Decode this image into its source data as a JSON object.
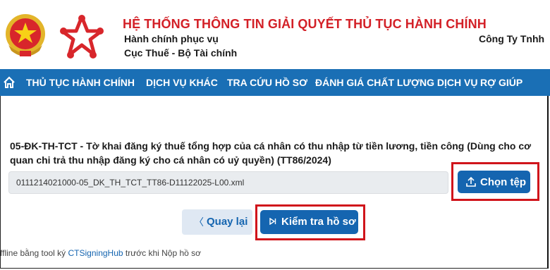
{
  "header": {
    "title": "HỆ THỐNG THÔNG TIN GIẢI QUYẾT THỦ TỤC HÀNH CHÍNH",
    "subtitle_1": "Hành chính phục vụ",
    "subtitle_2": "Cục Thuế - Bộ Tài chính",
    "company": "Công Ty Tnhh",
    "emblem_icon": "national-emblem-icon",
    "logo_icon": "public-service-logo-icon"
  },
  "nav": {
    "home_icon": "home-icon",
    "items": [
      "THỦ TỤC HÀNH CHÍNH",
      "DỊCH VỤ KHÁC",
      "TRA CỨU HỒ SƠ",
      "ĐÁNH GIÁ CHẤT LƯỢNG DỊCH VỤ",
      "RỢ GIÚP"
    ]
  },
  "form": {
    "title": "05-ĐK-TH-TCT - Tờ khai đăng ký thuế tổng hợp của cá nhân có thu nhập từ tiền lương, tiền công (Dùng cho cơ quan chi trả thu nhập đăng ký cho cá nhân có uỷ quyền) (TT86/2024)",
    "file_name": "0111214021000-05_DK_TH_TCT_TT86-D11122025-L00.xml",
    "choose_file_label": "Chọn tệp",
    "back_label": "Quay lại",
    "check_label": "Kiểm tra hồ sơ"
  },
  "footer": {
    "prefix": "ffline bằng tool ký ",
    "link": "CTSigningHub",
    "suffix": " trước khi Nộp hồ sơ"
  },
  "colors": {
    "title_red": "#d32027",
    "nav_blue": "#1a6fb5",
    "button_blue": "#1565b0",
    "highlight_red": "#d0141b"
  }
}
